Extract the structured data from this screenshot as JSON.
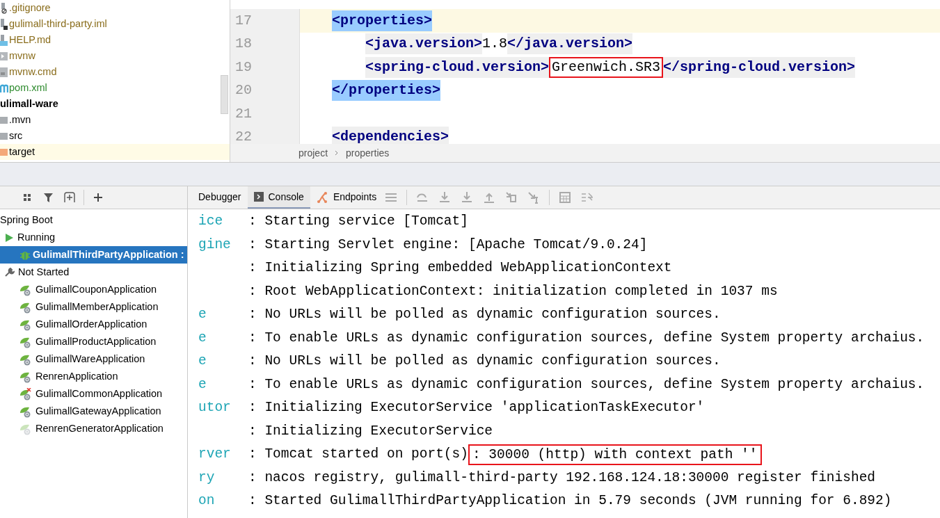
{
  "project_tree": [
    {
      "name": ".gitignore",
      "kind": "ignored",
      "bold": false
    },
    {
      "name": "gulimall-third-party.iml",
      "kind": "module",
      "bold": false
    },
    {
      "name": "HELP.md",
      "kind": "markdown",
      "bold": false
    },
    {
      "name": "mvnw",
      "kind": "script",
      "bold": false
    },
    {
      "name": "mvnw.cmd",
      "kind": "text",
      "bold": false
    },
    {
      "name": "pom.xml",
      "kind": "maven",
      "bold": false
    },
    {
      "name": "ulimall-ware",
      "kind": "module-root",
      "bold": true
    },
    {
      "name": ".mvn",
      "kind": "folder",
      "bold": false
    },
    {
      "name": "src",
      "kind": "folder",
      "bold": false
    },
    {
      "name": "target",
      "kind": "excluded",
      "bold": false
    }
  ],
  "editor": {
    "lines": [
      {
        "number": "17",
        "current": true,
        "segments": [
          {
            "text": "<properties>",
            "kind": "tag",
            "matched": true,
            "boxed": false
          }
        ],
        "children": [
          {
            "number": "18",
            "current": false,
            "segments": [
              {
                "text": "<java.version>",
                "kind": "tag",
                "matched": false,
                "boxed": false
              },
              {
                "text": "1.8",
                "kind": "value",
                "matched": false,
                "boxed": false
              },
              {
                "text": "</java.version>",
                "kind": "tag",
                "matched": false,
                "boxed": false
              }
            ]
          },
          {
            "number": "19",
            "current": false,
            "segments": [
              {
                "text": "<spring-cloud.version>",
                "kind": "tag",
                "matched": false,
                "boxed": false
              },
              {
                "text": "Greenwich.SR3",
                "kind": "value",
                "matched": false,
                "boxed": true
              },
              {
                "text": "</spring-cloud.version>",
                "kind": "tag",
                "matched": false,
                "boxed": false
              }
            ]
          }
        ]
      },
      {
        "number": "20",
        "current": false,
        "segments": [
          {
            "text": "</properties>",
            "kind": "tag",
            "matched": true,
            "boxed": false
          }
        ]
      },
      {
        "number": "21",
        "current": false
      },
      {
        "number": "22",
        "current": false,
        "segments": [
          {
            "text": "<dependencies>",
            "kind": "tag",
            "matched": false,
            "boxed": false
          }
        ]
      }
    ],
    "breadcrumb": [
      "project",
      "properties"
    ]
  },
  "run_tabs": [
    {
      "label": "Debugger",
      "kind": "plain",
      "selected": false
    },
    {
      "label": "Console",
      "kind": "console",
      "selected": true
    },
    {
      "label": "Endpoints",
      "kind": "endpoints",
      "selected": false
    }
  ],
  "run_tree": {
    "label": "Spring Boot",
    "children": [
      {
        "label": "Running",
        "kind": "running",
        "children": [
          {
            "label": "GulimallThirdPartyApplication :",
            "kind": "debugging",
            "selected": true
          }
        ]
      },
      {
        "label": "Not Started",
        "kind": "stopped",
        "children": [
          {
            "label": "GulimallCouponApplication",
            "kind": "normal",
            "selected": false
          },
          {
            "label": "GulimallMemberApplication",
            "kind": "normal",
            "selected": false
          },
          {
            "label": "GulimallOrderApplication",
            "kind": "normal",
            "selected": false
          },
          {
            "label": "GulimallProductApplication",
            "kind": "normal",
            "selected": false
          },
          {
            "label": "GulimallWareApplication",
            "kind": "normal",
            "selected": false
          },
          {
            "label": "RenrenApplication",
            "kind": "normal",
            "selected": false
          },
          {
            "label": "GulimallCommonApplication",
            "kind": "error",
            "selected": false
          },
          {
            "label": "GulimallGatewayApplication",
            "kind": "normal",
            "selected": false
          },
          {
            "label": "RenrenGeneratorApplication",
            "kind": "faded",
            "selected": false
          }
        ]
      }
    ]
  },
  "console": [
    {
      "source": "ice",
      "segments": [
        {
          "text": ": Starting service [Tomcat]",
          "boxed": false
        }
      ]
    },
    {
      "source": "gine",
      "segments": [
        {
          "text": ": Starting Servlet engine: [Apache Tomcat/9.0.24]",
          "boxed": false
        }
      ]
    },
    {
      "segments": [
        {
          "text": ": Initializing Spring embedded WebApplicationContext",
          "boxed": false
        }
      ]
    },
    {
      "segments": [
        {
          "text": ": Root WebApplicationContext: initialization completed in 1037 ms",
          "boxed": false
        }
      ]
    },
    {
      "source": "e",
      "segments": [
        {
          "text": ": No URLs will be polled as dynamic configuration sources.",
          "boxed": false
        }
      ]
    },
    {
      "source": "e",
      "segments": [
        {
          "text": ": To enable URLs as dynamic configuration sources, define System property archaius.",
          "boxed": false
        }
      ]
    },
    {
      "source": "e",
      "segments": [
        {
          "text": ": No URLs will be polled as dynamic configuration sources.",
          "boxed": false
        }
      ]
    },
    {
      "source": "e",
      "segments": [
        {
          "text": ": To enable URLs as dynamic configuration sources, define System property archaius.",
          "boxed": false
        }
      ]
    },
    {
      "source": "utor",
      "segments": [
        {
          "text": ": Initializing ExecutorService 'applicationTaskExecutor'",
          "boxed": false
        }
      ]
    },
    {
      "segments": [
        {
          "text": ": Initializing ExecutorService",
          "boxed": false
        }
      ]
    },
    {
      "source": "rver",
      "segments": [
        {
          "text": ": Tomcat started on port(s)",
          "boxed": false
        },
        {
          "text": ": 30000 (http) with context path ''",
          "boxed": true
        }
      ]
    },
    {
      "source": "ry",
      "segments": [
        {
          "text": ": nacos registry, gulimall-third-party 192.168.124.18:30000 register finished",
          "boxed": false
        }
      ]
    },
    {
      "source": "on",
      "segments": [
        {
          "text": ": Started GulimallThirdPartyApplication in 5.79 seconds (JVM running for 6.892)",
          "boxed": false
        }
      ]
    }
  ]
}
